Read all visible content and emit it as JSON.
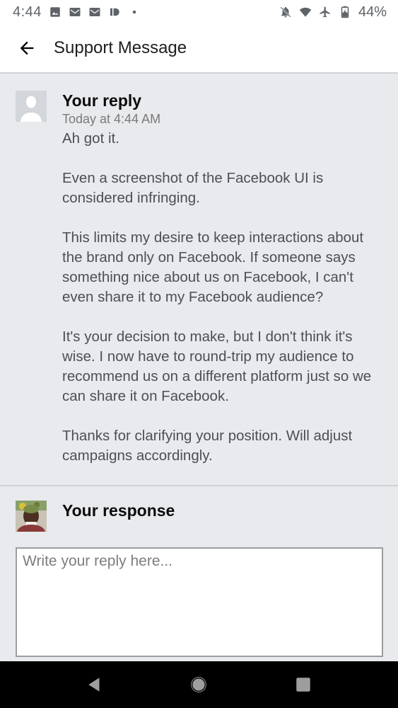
{
  "status_bar": {
    "time": "4:44",
    "battery_percent": "44%",
    "left_icons": [
      "image-icon",
      "gmail-icon",
      "gmail-icon",
      "id-icon",
      "dot-icon"
    ],
    "right_icons": [
      "notifications-off-icon",
      "wifi-icon",
      "airplane-icon",
      "battery-charging-icon"
    ]
  },
  "app_bar": {
    "title": "Support Message"
  },
  "message": {
    "author": "Your reply",
    "timestamp": "Today at 4:44 AM",
    "paragraphs": [
      "Ah got it.",
      "Even a screenshot of the Facebook UI is considered infringing.",
      "This limits my desire to keep interactions about the brand only on Facebook. If someone says something nice about us on Facebook, I can't even share it to my Facebook audience?",
      "It's your decision to make, but I don't think it's wise. I now have to round-trip my audience to recommend us on a different platform just so we can share it on Facebook.",
      "Thanks for clarifying your position. Will adjust campaigns accordingly."
    ]
  },
  "response": {
    "heading": "Your response",
    "placeholder": "Write your reply here...",
    "value": ""
  },
  "nav_bar": {
    "icons": [
      "back-triangle-icon",
      "home-circle-icon",
      "recents-square-icon"
    ]
  },
  "colors": {
    "background": "#e9eaed",
    "text_primary": "#0c0c0c",
    "text_body": "#4b4f56",
    "text_muted": "#7a7a7a",
    "nav_bar": "#000000"
  }
}
